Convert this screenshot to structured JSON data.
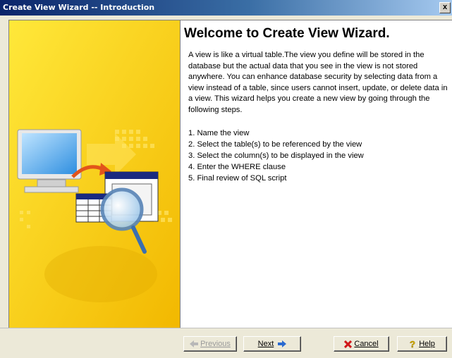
{
  "window": {
    "title": "Create View Wizard -- Introduction",
    "close_label": "x"
  },
  "content": {
    "heading": "Welcome to Create View Wizard.",
    "description": "A view is like a virtual table.The view you define will be stored in the database but the actual data that you see in the view is not stored anywhere. You can enhance database security by selecting data from a view instead of a table, since users cannot insert, update, or delete data in a view. This wizard helps you create a new view by going through the following steps.",
    "steps": [
      "1. Name the view",
      "2. Select the table(s) to be referenced by the view",
      "3. Select the column(s) to be displayed in the view",
      "4. Enter the WHERE clause",
      "5. Final review of SQL script"
    ]
  },
  "buttons": {
    "previous": "Previous",
    "next": "Next",
    "cancel": "Cancel",
    "help": "Help"
  },
  "colors": {
    "sidebar": "#fcd800",
    "title_bar": "#0a246a"
  }
}
